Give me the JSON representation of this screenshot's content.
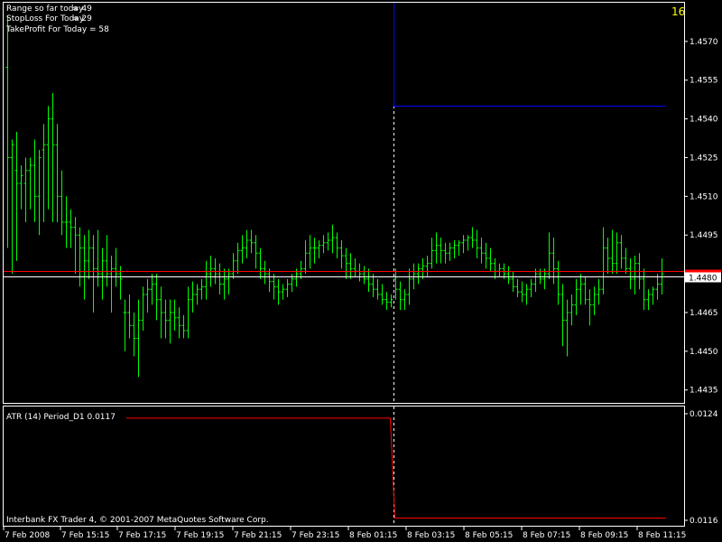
{
  "colors": {
    "background": "#000000",
    "border": "#ffffff",
    "bar": "#00ff00",
    "bid_line": "#ff0000",
    "ask_line": "#ffffff",
    "target_line": "#0000ff",
    "period_separator": "#ffffff",
    "atr_line": "#ff0000",
    "counter": "#ffff00",
    "price_label_bg": "#ffffff",
    "price_label_text": "#000000"
  },
  "info": {
    "range_label": "Range so far today",
    "range_value": "= 49",
    "stoploss_label": "StopLoss For Today",
    "stoploss_value": "= 29",
    "takeprofit_label": "TakeProfit For Today",
    "takeprofit_value": "= 58"
  },
  "counter": "16",
  "current_price_label": "1.4480",
  "indicator": {
    "label": "ATR (14) Period_D1 0.0117"
  },
  "copyright": "Interbank FX Trader 4, © 2001-2007 MetaQuotes Software Corp.",
  "chart_data": [
    {
      "type": "bar",
      "subtype": "ohlc",
      "symbol_timeframe": "",
      "ylim": [
        1.443,
        1.4585
      ],
      "yticks": [
        "1.4570",
        "1.4555",
        "1.4540",
        "1.4525",
        "1.4510",
        "1.4495",
        "1.4480",
        "1.4465",
        "1.4450",
        "1.4435"
      ],
      "xticks": [
        "7 Feb 2008",
        "7 Feb 15:15",
        "7 Feb 17:15",
        "7 Feb 19:15",
        "7 Feb 21:15",
        "7 Feb 23:15",
        "8 Feb 01:15",
        "8 Feb 03:15",
        "8 Feb 05:15",
        "8 Feb 07:15",
        "8 Feb 09:15",
        "8 Feb 11:15"
      ],
      "bid_price": 1.4481,
      "ask_price": 1.4479,
      "target_level": 1.4545,
      "target_start_bar": 86,
      "separator_bar": 86,
      "bars": [
        [
          1.456,
          1.458,
          1.449,
          1.4525
        ],
        [
          1.4525,
          1.4532,
          1.448,
          1.453
        ],
        [
          1.452,
          1.4535,
          1.4485,
          1.4515
        ],
        [
          1.4515,
          1.4522,
          1.4505,
          1.4518
        ],
        [
          1.4515,
          1.4525,
          1.45,
          1.452
        ],
        [
          1.452,
          1.4525,
          1.4505,
          1.4522
        ],
        [
          1.4522,
          1.4532,
          1.45,
          1.451
        ],
        [
          1.451,
          1.4528,
          1.4495,
          1.4525
        ],
        [
          1.4528,
          1.4538,
          1.45,
          1.453
        ],
        [
          1.453,
          1.4545,
          1.4505,
          1.454
        ],
        [
          1.454,
          1.455,
          1.45,
          1.453
        ],
        [
          1.453,
          1.4538,
          1.45,
          1.451
        ],
        [
          1.451,
          1.452,
          1.4495,
          1.45
        ],
        [
          1.45,
          1.451,
          1.449,
          1.45
        ],
        [
          1.45,
          1.4505,
          1.449,
          1.4498
        ],
        [
          1.4498,
          1.4502,
          1.448,
          1.4495
        ],
        [
          1.4495,
          1.4498,
          1.4475,
          1.449
        ],
        [
          1.449,
          1.4495,
          1.447,
          1.4485
        ],
        [
          1.4485,
          1.4497,
          1.4478,
          1.449
        ],
        [
          1.449,
          1.4495,
          1.4465,
          1.4482
        ],
        [
          1.4482,
          1.4497,
          1.4475,
          1.448
        ],
        [
          1.448,
          1.449,
          1.447,
          1.4485
        ],
        [
          1.4485,
          1.4495,
          1.4475,
          1.448
        ],
        [
          1.448,
          1.4487,
          1.4465,
          1.4482
        ],
        [
          1.4482,
          1.449,
          1.4475,
          1.448
        ],
        [
          1.448,
          1.4483,
          1.447,
          1.4478
        ],
        [
          1.4465,
          1.447,
          1.445,
          1.4465
        ],
        [
          1.4465,
          1.4472,
          1.4455,
          1.446
        ],
        [
          1.446,
          1.4465,
          1.4448,
          1.4455
        ],
        [
          1.4455,
          1.447,
          1.444,
          1.4462
        ],
        [
          1.4462,
          1.4475,
          1.4458,
          1.4472
        ],
        [
          1.4472,
          1.4478,
          1.4465,
          1.4474
        ],
        [
          1.4474,
          1.448,
          1.4468,
          1.4476
        ],
        [
          1.4476,
          1.448,
          1.4462,
          1.447
        ],
        [
          1.447,
          1.4475,
          1.4455,
          1.4465
        ],
        [
          1.4465,
          1.447,
          1.4455,
          1.4462
        ],
        [
          1.4462,
          1.447,
          1.4453,
          1.4465
        ],
        [
          1.4465,
          1.447,
          1.4458,
          1.4463
        ],
        [
          1.4463,
          1.4467,
          1.4455,
          1.446
        ],
        [
          1.446,
          1.4464,
          1.4455,
          1.4458
        ],
        [
          1.4458,
          1.4475,
          1.4455,
          1.447
        ],
        [
          1.447,
          1.4477,
          1.4465,
          1.4472
        ],
        [
          1.4472,
          1.4476,
          1.4468,
          1.4474
        ],
        [
          1.4474,
          1.4478,
          1.447,
          1.4475
        ],
        [
          1.4475,
          1.4485,
          1.447,
          1.448
        ],
        [
          1.448,
          1.4487,
          1.4475,
          1.4482
        ],
        [
          1.4482,
          1.4486,
          1.4476,
          1.448
        ],
        [
          1.448,
          1.4484,
          1.4472,
          1.4476
        ],
        [
          1.4476,
          1.4482,
          1.447,
          1.4478
        ],
        [
          1.4478,
          1.4482,
          1.4472,
          1.448
        ],
        [
          1.448,
          1.4488,
          1.4478,
          1.4485
        ],
        [
          1.4485,
          1.4492,
          1.448,
          1.4489
        ],
        [
          1.4489,
          1.4495,
          1.4484,
          1.449
        ],
        [
          1.449,
          1.4497,
          1.4486,
          1.4493
        ],
        [
          1.4493,
          1.4497,
          1.4488,
          1.4492
        ],
        [
          1.4492,
          1.4495,
          1.4482,
          1.4488
        ],
        [
          1.4488,
          1.449,
          1.4478,
          1.4482
        ],
        [
          1.4482,
          1.4485,
          1.4476,
          1.448
        ],
        [
          1.448,
          1.4482,
          1.4473,
          1.4477
        ],
        [
          1.4477,
          1.448,
          1.447,
          1.4475
        ],
        [
          1.4475,
          1.4478,
          1.4468,
          1.4473
        ],
        [
          1.4473,
          1.4476,
          1.447,
          1.4474
        ],
        [
          1.4474,
          1.4478,
          1.4471,
          1.4476
        ],
        [
          1.4476,
          1.448,
          1.4473,
          1.4478
        ],
        [
          1.4478,
          1.4482,
          1.4475,
          1.448
        ],
        [
          1.448,
          1.4485,
          1.4478,
          1.4482
        ],
        [
          1.4482,
          1.4493,
          1.448,
          1.4488
        ],
        [
          1.4488,
          1.4495,
          1.4482,
          1.449
        ],
        [
          1.449,
          1.4494,
          1.4484,
          1.449
        ],
        [
          1.449,
          1.4493,
          1.4486,
          1.4491
        ],
        [
          1.4491,
          1.4495,
          1.4488,
          1.4492
        ],
        [
          1.4492,
          1.4496,
          1.4489,
          1.4493
        ],
        [
          1.4493,
          1.4499,
          1.4488,
          1.4494
        ],
        [
          1.4494,
          1.4496,
          1.4486,
          1.449
        ],
        [
          1.449,
          1.4493,
          1.4482,
          1.4487
        ],
        [
          1.4487,
          1.449,
          1.4478,
          1.4484
        ],
        [
          1.4484,
          1.4488,
          1.4478,
          1.4482
        ],
        [
          1.4482,
          1.4486,
          1.4479,
          1.4481
        ],
        [
          1.4481,
          1.4484,
          1.4477,
          1.448
        ],
        [
          1.448,
          1.4483,
          1.4476,
          1.4478
        ],
        [
          1.4478,
          1.4482,
          1.4473,
          1.4476
        ],
        [
          1.4476,
          1.448,
          1.4471,
          1.4474
        ],
        [
          1.4474,
          1.4478,
          1.447,
          1.4472
        ],
        [
          1.4472,
          1.4476,
          1.4468,
          1.447
        ],
        [
          1.447,
          1.4473,
          1.4466,
          1.4469
        ],
        [
          1.4469,
          1.4472,
          1.4467,
          1.447
        ],
        [
          1.4478,
          1.4482,
          1.447,
          1.4474
        ],
        [
          1.4474,
          1.4477,
          1.4466,
          1.447
        ],
        [
          1.447,
          1.4474,
          1.4466,
          1.4472
        ],
        [
          1.4472,
          1.4482,
          1.4468,
          1.4478
        ],
        [
          1.4478,
          1.4484,
          1.4474,
          1.448
        ],
        [
          1.448,
          1.4484,
          1.4476,
          1.4482
        ],
        [
          1.4482,
          1.4486,
          1.4478,
          1.4483
        ],
        [
          1.4483,
          1.4487,
          1.4479,
          1.4484
        ],
        [
          1.4484,
          1.4494,
          1.4482,
          1.4489
        ],
        [
          1.4489,
          1.4496,
          1.4484,
          1.4491
        ],
        [
          1.4491,
          1.4494,
          1.4484,
          1.4489
        ],
        [
          1.4489,
          1.4492,
          1.4484,
          1.4488
        ],
        [
          1.4488,
          1.4492,
          1.4485,
          1.449
        ],
        [
          1.449,
          1.4493,
          1.4486,
          1.4491
        ],
        [
          1.4491,
          1.4493,
          1.4487,
          1.4492
        ],
        [
          1.4492,
          1.4495,
          1.4488,
          1.4493
        ],
        [
          1.4493,
          1.4495,
          1.4489,
          1.4494
        ],
        [
          1.4494,
          1.4498,
          1.449,
          1.4493
        ],
        [
          1.4493,
          1.4497,
          1.4486,
          1.449
        ],
        [
          1.449,
          1.4494,
          1.4484,
          1.4488
        ],
        [
          1.4488,
          1.4492,
          1.4482,
          1.4486
        ],
        [
          1.4486,
          1.449,
          1.4481,
          1.4484
        ],
        [
          1.4484,
          1.4486,
          1.4478,
          1.4481
        ],
        [
          1.4481,
          1.4484,
          1.4479,
          1.4482
        ],
        [
          1.4482,
          1.4484,
          1.4478,
          1.448
        ],
        [
          1.448,
          1.4483,
          1.4476,
          1.4478
        ],
        [
          1.4478,
          1.4481,
          1.4473,
          1.4475
        ],
        [
          1.4475,
          1.4478,
          1.4471,
          1.4473
        ],
        [
          1.4473,
          1.4477,
          1.4469,
          1.4472
        ],
        [
          1.4472,
          1.4476,
          1.4468,
          1.4474
        ],
        [
          1.4474,
          1.4478,
          1.4471,
          1.4476
        ],
        [
          1.4476,
          1.4482,
          1.4473,
          1.448
        ],
        [
          1.448,
          1.4482,
          1.4476,
          1.4478
        ],
        [
          1.4478,
          1.4482,
          1.4474,
          1.448
        ],
        [
          1.448,
          1.4496,
          1.4478,
          1.4488
        ],
        [
          1.4488,
          1.4494,
          1.4476,
          1.4482
        ],
        [
          1.4482,
          1.4485,
          1.4468,
          1.4472
        ],
        [
          1.4472,
          1.4476,
          1.4452,
          1.4462
        ],
        [
          1.4462,
          1.447,
          1.4448,
          1.4465
        ],
        [
          1.4465,
          1.4472,
          1.446,
          1.4468
        ],
        [
          1.4468,
          1.4478,
          1.4464,
          1.4474
        ],
        [
          1.4474,
          1.448,
          1.4468,
          1.4476
        ],
        [
          1.4476,
          1.4479,
          1.4468,
          1.447
        ],
        [
          1.447,
          1.4474,
          1.446,
          1.4468
        ],
        [
          1.4468,
          1.4475,
          1.4464,
          1.4472
        ],
        [
          1.4472,
          1.4478,
          1.4468,
          1.4474
        ],
        [
          1.4474,
          1.4498,
          1.4472,
          1.449
        ],
        [
          1.449,
          1.4494,
          1.448,
          1.4486
        ],
        [
          1.4486,
          1.4497,
          1.448,
          1.4484
        ],
        [
          1.4484,
          1.4496,
          1.448,
          1.4492
        ],
        [
          1.4492,
          1.4495,
          1.4482,
          1.4486
        ],
        [
          1.4486,
          1.449,
          1.448,
          1.4482
        ],
        [
          1.4482,
          1.4486,
          1.4474,
          1.4478
        ],
        [
          1.4478,
          1.4487,
          1.4472,
          1.4484
        ],
        [
          1.4484,
          1.4488,
          1.4474,
          1.4478
        ],
        [
          1.4478,
          1.4482,
          1.4466,
          1.447
        ],
        [
          1.447,
          1.4474,
          1.4466,
          1.4472
        ],
        [
          1.4472,
          1.4475,
          1.4468,
          1.4474
        ],
        [
          1.4474,
          1.448,
          1.447,
          1.4476
        ],
        [
          1.4476,
          1.4486,
          1.4472,
          1.448
        ],
        [
          1.448,
          1.4484,
          1.4474,
          1.4478
        ],
        [
          1.4478,
          1.4483,
          1.4472,
          1.4476
        ]
      ]
    },
    {
      "type": "line",
      "label": "ATR (14) Period_D1 0.0117",
      "ylim": [
        0.0116,
        0.0124
      ],
      "yticks": [
        "0.0124",
        "0.0116"
      ],
      "segments": [
        {
          "from_bar": 27,
          "to_bar": 85,
          "value": 0.01237
        },
        {
          "from_bar": 86,
          "to_bar": 147,
          "value": 0.01162
        }
      ]
    }
  ]
}
